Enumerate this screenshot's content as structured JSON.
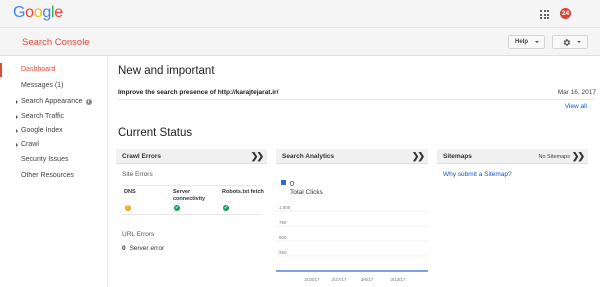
{
  "google_logo": [
    "G",
    "o",
    "o",
    "g",
    "l",
    "e"
  ],
  "google_logo_colors": [
    "#4285f4",
    "#ea4335",
    "#fbbc05",
    "#4285f4",
    "#34a853",
    "#ea4335"
  ],
  "topbar": {
    "apps_icon": "apps-grid-icon",
    "notification_count": "24"
  },
  "appbar": {
    "product_title": "Search Console",
    "help_label": "Help",
    "settings_icon": "gear-icon"
  },
  "sidebar": {
    "items": [
      {
        "label": "Dashboard",
        "active": true,
        "expandable": false
      },
      {
        "label": "Messages (1)",
        "active": false,
        "expandable": false
      },
      {
        "label": "Search Appearance",
        "active": false,
        "expandable": true,
        "info": true
      },
      {
        "label": "Search Traffic",
        "active": false,
        "expandable": true
      },
      {
        "label": "Google Index",
        "active": false,
        "expandable": true
      },
      {
        "label": "Crawl",
        "active": false,
        "expandable": true
      },
      {
        "label": "Security Issues",
        "active": false,
        "expandable": false
      },
      {
        "label": "Other Resources",
        "active": false,
        "expandable": false
      }
    ]
  },
  "main": {
    "new_important_title": "New and important",
    "notice_text": "Improve the search presence of http://karajtejarat.ir/",
    "notice_date": "Mar 16, 2017",
    "view_all": "View all",
    "current_status_title": "Current Status"
  },
  "crawl_errors": {
    "title": "Crawl Errors",
    "site_errors": "Site Errors",
    "columns": [
      "DNS",
      "Server\nconnectivity",
      "Robots.txt fetch"
    ],
    "column_status": [
      "warning",
      "ok",
      "ok"
    ],
    "url_errors": "URL Errors",
    "server_error_count": "0",
    "server_error_label": "Server error"
  },
  "search_analytics": {
    "title": "Search Analytics",
    "clicks": "0",
    "total_clicks_label": "Total Clicks",
    "series_color": "#3367d6"
  },
  "sitemaps": {
    "title": "Sitemaps",
    "aux": "No Sitemaps",
    "link": "Why submit a Sitemap?"
  },
  "chart_data": {
    "type": "line",
    "title": "",
    "xlabel": "",
    "ylabel": "",
    "x": [
      "2/20/17",
      "2/27/17",
      "3/6/17",
      "3/13/17"
    ],
    "y_ticks": [
      "1,000",
      "750",
      "500",
      "250"
    ],
    "ylim": [
      0,
      1000
    ],
    "series": [
      {
        "values": [
          0,
          0,
          0,
          0
        ]
      }
    ],
    "grid": true
  }
}
